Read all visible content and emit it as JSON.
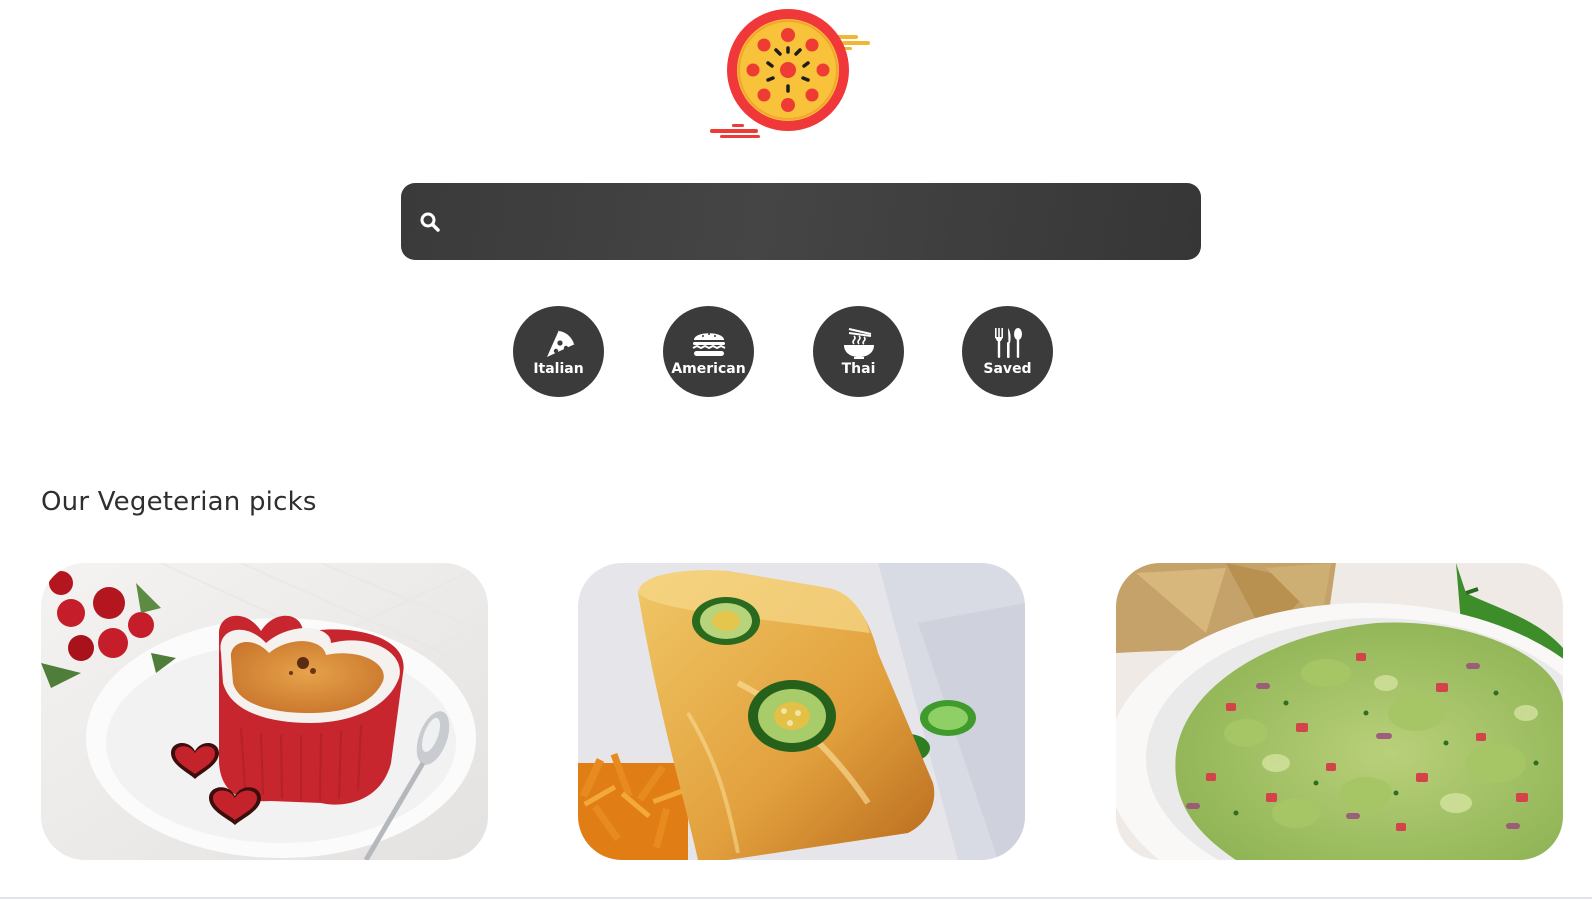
{
  "brand": {
    "logo_icon": "pizza-logo-icon",
    "colors": {
      "pizza_ring": "#f0383a",
      "pizza_cheese": "#f8c23a",
      "pepperoni": "#ee3b33",
      "speed_lines": "#f2b632"
    }
  },
  "search": {
    "icon": "search-icon",
    "value": "",
    "placeholder": ""
  },
  "categories": [
    {
      "label": "Italian",
      "icon": "pizza-slice-icon"
    },
    {
      "label": "American",
      "icon": "burger-icon"
    },
    {
      "label": "Thai",
      "icon": "noodle-bowl-icon"
    },
    {
      "label": "Saved",
      "icon": "cutlery-icon"
    }
  ],
  "section": {
    "title": "Our Vegeterian picks"
  },
  "picks": [
    {
      "image": "creme-brulee-heart-photo"
    },
    {
      "image": "jalapeno-cornbread-photo"
    },
    {
      "image": "guacamole-photo"
    }
  ],
  "theme": {
    "dark_control": "#3b3b3b",
    "text": "#2f2f2f",
    "background": "#ffffff"
  }
}
